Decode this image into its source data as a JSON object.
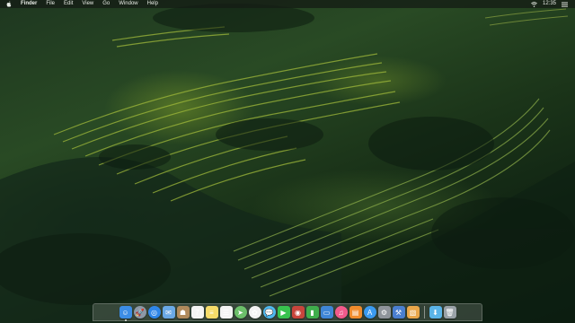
{
  "menubar": {
    "apple_icon": "apple-logo-icon",
    "items": [
      "Finder",
      "File",
      "Edit",
      "View",
      "Go",
      "Window",
      "Help"
    ],
    "status_icons": [
      "wifi-icon",
      "list-icon"
    ],
    "clock": "12:35"
  },
  "dock": {
    "apps": [
      {
        "name": "finder-icon",
        "color": "#3c8de6",
        "glyph": "☺"
      },
      {
        "name": "launchpad-icon",
        "color": "#8c98a6",
        "glyph": "🚀"
      },
      {
        "name": "safari-icon",
        "color": "#2f86e8",
        "glyph": "◎"
      },
      {
        "name": "mail-icon",
        "color": "#6aa9e6",
        "glyph": "✉"
      },
      {
        "name": "contacts-icon",
        "color": "#b08a5c",
        "glyph": "☗"
      },
      {
        "name": "calendar-icon",
        "color": "#f4f4f4",
        "glyph": "7"
      },
      {
        "name": "notes-icon",
        "color": "#f6dc6a",
        "glyph": "≡"
      },
      {
        "name": "reminders-icon",
        "color": "#f4f4f4",
        "glyph": "☰"
      },
      {
        "name": "maps-icon",
        "color": "#6cc06a",
        "glyph": "➤"
      },
      {
        "name": "photos-icon",
        "color": "#f3f3f3",
        "glyph": "✿"
      },
      {
        "name": "messages-icon",
        "color": "#4fb8ef",
        "glyph": "💬"
      },
      {
        "name": "facetime-icon",
        "color": "#38c24e",
        "glyph": "▶"
      },
      {
        "name": "photo-booth-icon",
        "color": "#c8453c",
        "glyph": "◉"
      },
      {
        "name": "numbers-icon",
        "color": "#3fae4c",
        "glyph": "▮"
      },
      {
        "name": "keynote-icon",
        "color": "#3f86d6",
        "glyph": "▭"
      },
      {
        "name": "itunes-icon",
        "color": "#f25a8c",
        "glyph": "♫"
      },
      {
        "name": "ibooks-icon",
        "color": "#f08c2c",
        "glyph": "▤"
      },
      {
        "name": "app-store-icon",
        "color": "#3a9af0",
        "glyph": "A"
      },
      {
        "name": "system-preferences-icon",
        "color": "#8e949a",
        "glyph": "⚙"
      }
    ],
    "extras": [
      {
        "name": "xcode-icon",
        "color": "#4a7fd0",
        "glyph": "⚒"
      },
      {
        "name": "preview-icon",
        "color": "#e9a64a",
        "glyph": "▧"
      }
    ],
    "right": [
      {
        "name": "downloads-folder-icon",
        "color": "#5ab4e8",
        "glyph": "⬇"
      },
      {
        "name": "trash-icon",
        "color": "#9aa2a8",
        "glyph": "🗑"
      }
    ]
  }
}
